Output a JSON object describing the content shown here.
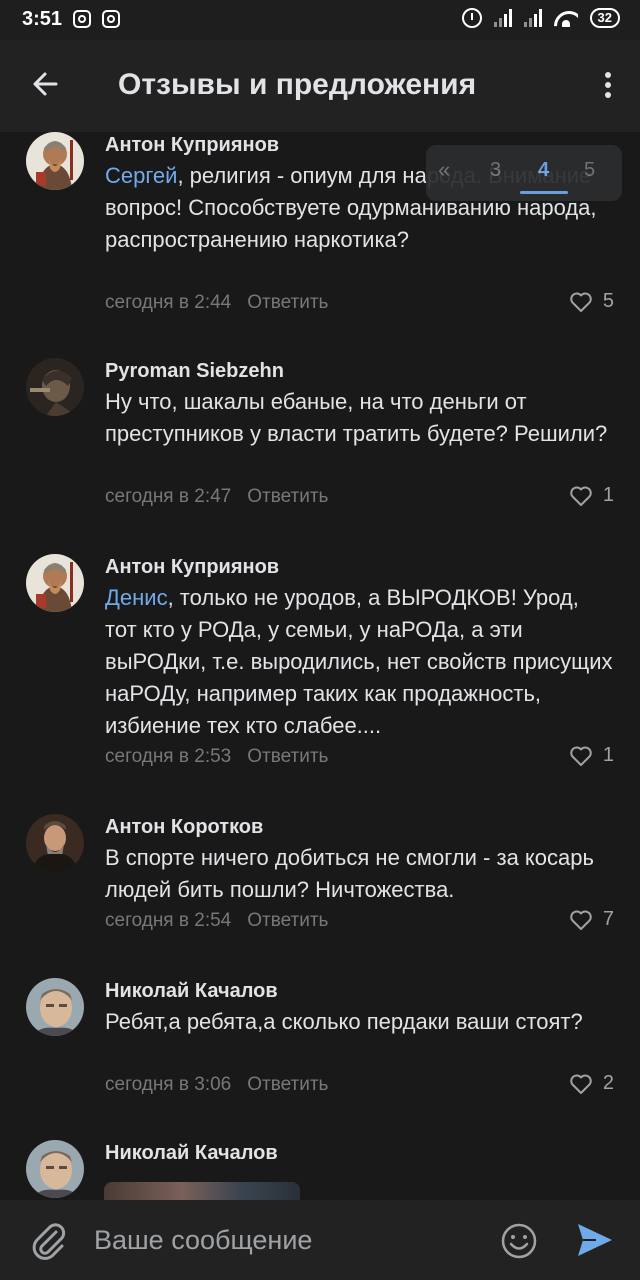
{
  "status_bar": {
    "time": "3:51",
    "battery": "32"
  },
  "app_bar": {
    "title": "Отзывы и предложения"
  },
  "pagination": {
    "prev": "«",
    "pages": [
      "3",
      "4",
      "5"
    ],
    "current": "4"
  },
  "comments": [
    {
      "author": "Антон Куприянов",
      "mention": "Сергей",
      "text": ", религия - опиум для народа. Внимание вопрос! Способствуете одурманиванию народа, распространению наркотика?",
      "time": "сегодня в 2:44",
      "reply": "Ответить",
      "likes": "5"
    },
    {
      "author": "Pyroman Siebzehn",
      "mention": "",
      "text": "Ну что, шакалы ебаные, на что деньги от преступников у власти тратить будете? Решили?",
      "time": "сегодня в 2:47",
      "reply": "Ответить",
      "likes": "1"
    },
    {
      "author": "Антон Куприянов",
      "mention": "Денис",
      "text": ", только не уродов, а ВЫРОДКОВ! Урод, тот кто у РОДа, у семьи, у наРОДа, а эти выРОДки, т.е. выродились, нет свойств присущих наРОДу, например таких как продажность, избиение тех кто слабее....",
      "time": "сегодня в 2:53",
      "reply": "Ответить",
      "likes": "1"
    },
    {
      "author": "Антон Коротков",
      "mention": "",
      "text": "В спорте ничего добиться не смогли - за косарь людей бить пошли? Ничтожества.",
      "time": "сегодня в 2:54",
      "reply": "Ответить",
      "likes": "7"
    },
    {
      "author": "Николай Качалов",
      "mention": "",
      "text": "Ребят,а ребята,а сколько пердаки ваши стоят?",
      "time": "сегодня в 3:06",
      "reply": "Ответить",
      "likes": "2"
    },
    {
      "author": "Николай Качалов"
    }
  ],
  "composer": {
    "placeholder": "Ваше сообщение"
  },
  "colors": {
    "background": "#191919",
    "bar": "#222222",
    "accent": "#71aaeb",
    "secondary_text": "#76787a"
  }
}
